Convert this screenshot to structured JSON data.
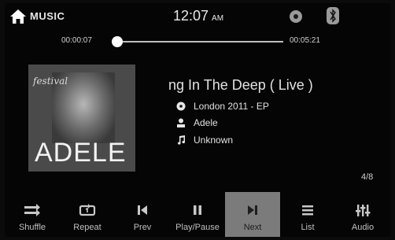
{
  "header": {
    "title": "MUSIC",
    "time": "12:07",
    "ampm": "AM",
    "icons": [
      "home-icon",
      "disc-icon",
      "bluetooth-icon"
    ]
  },
  "progress": {
    "elapsed": "00:00:07",
    "total": "00:05:21",
    "fraction": 0.02
  },
  "album_art": {
    "festival_text": "festival",
    "artist_text": "ADELE"
  },
  "track": {
    "title": "ng In The Deep ( Live )",
    "album": "London 2011 - EP",
    "artist": "Adele",
    "genre": "Unknown"
  },
  "counter": "4/8",
  "toolbar": {
    "buttons": [
      {
        "label": "Shuffle",
        "icon": "shuffle-icon"
      },
      {
        "label": "Repeat",
        "icon": "repeat-icon"
      },
      {
        "label": "Prev",
        "icon": "previous-icon"
      },
      {
        "label": "Play/Pause",
        "icon": "pause-icon"
      },
      {
        "label": "Next",
        "icon": "next-icon"
      },
      {
        "label": "List",
        "icon": "list-icon"
      },
      {
        "label": "Audio",
        "icon": "equalizer-icon"
      }
    ],
    "active": "Next"
  }
}
